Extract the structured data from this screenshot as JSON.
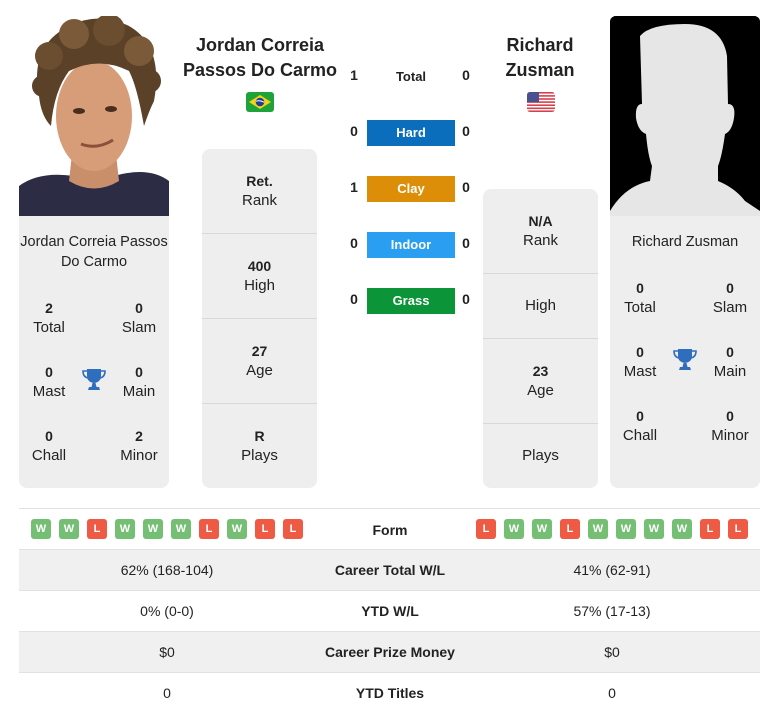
{
  "player1": {
    "name": "Jordan Correia Passos Do Carmo",
    "name_line1": "Jordan Correia",
    "name_line2": "Passos Do Carmo",
    "card_name": "Jordan Correia Passos Do Carmo",
    "country_flag": "brazil-flag",
    "photo": "player-photo",
    "titles": {
      "total": {
        "value": "2",
        "label": "Total"
      },
      "slam": {
        "value": "0",
        "label": "Slam"
      },
      "mast": {
        "value": "0",
        "label": "Mast"
      },
      "main": {
        "value": "0",
        "label": "Main"
      },
      "chall": {
        "value": "0",
        "label": "Chall"
      },
      "minor": {
        "value": "2",
        "label": "Minor"
      }
    },
    "stats": {
      "rank": {
        "value": "Ret.",
        "label": "Rank"
      },
      "high": {
        "value": "400",
        "label": "High"
      },
      "age": {
        "value": "27",
        "label": "Age"
      },
      "plays": {
        "value": "R",
        "label": "Plays"
      }
    },
    "form": [
      "W",
      "W",
      "L",
      "W",
      "W",
      "W",
      "L",
      "W",
      "L",
      "L"
    ]
  },
  "player2": {
    "name": "Richard Zusman",
    "name_line1": "Richard",
    "name_line2": "Zusman",
    "card_name": "Richard Zusman",
    "country_flag": "usa-flag",
    "photo": "silhouette-placeholder",
    "titles": {
      "total": {
        "value": "0",
        "label": "Total"
      },
      "slam": {
        "value": "0",
        "label": "Slam"
      },
      "mast": {
        "value": "0",
        "label": "Mast"
      },
      "main": {
        "value": "0",
        "label": "Main"
      },
      "chall": {
        "value": "0",
        "label": "Chall"
      },
      "minor": {
        "value": "0",
        "label": "Minor"
      }
    },
    "stats": {
      "rank": {
        "value": "N/A",
        "label": "Rank"
      },
      "high": {
        "value": "",
        "label": "High"
      },
      "age": {
        "value": "23",
        "label": "Age"
      },
      "plays": {
        "value": "",
        "label": "Plays"
      }
    },
    "form": [
      "L",
      "W",
      "W",
      "L",
      "W",
      "W",
      "W",
      "W",
      "L",
      "L"
    ]
  },
  "h2h": [
    {
      "label": "Total",
      "p1": "1",
      "p2": "0",
      "color": ""
    },
    {
      "label": "Hard",
      "p1": "0",
      "p2": "0",
      "color": "#0a6ebd"
    },
    {
      "label": "Clay",
      "p1": "1",
      "p2": "0",
      "color": "#dc8e08"
    },
    {
      "label": "Indoor",
      "p1": "0",
      "p2": "0",
      "color": "#2a9ff2"
    },
    {
      "label": "Grass",
      "p1": "0",
      "p2": "0",
      "color": "#0b9438"
    }
  ],
  "form_label": "Form",
  "comparison": [
    {
      "label": "Career Total W/L",
      "p1": "62% (168-104)",
      "p2": "41% (62-91)"
    },
    {
      "label": "YTD W/L",
      "p1": "0% (0-0)",
      "p2": "57% (17-13)"
    },
    {
      "label": "Career Prize Money",
      "p1": "$0",
      "p2": "$0"
    },
    {
      "label": "YTD Titles",
      "p1": "0",
      "p2": "0"
    }
  ]
}
